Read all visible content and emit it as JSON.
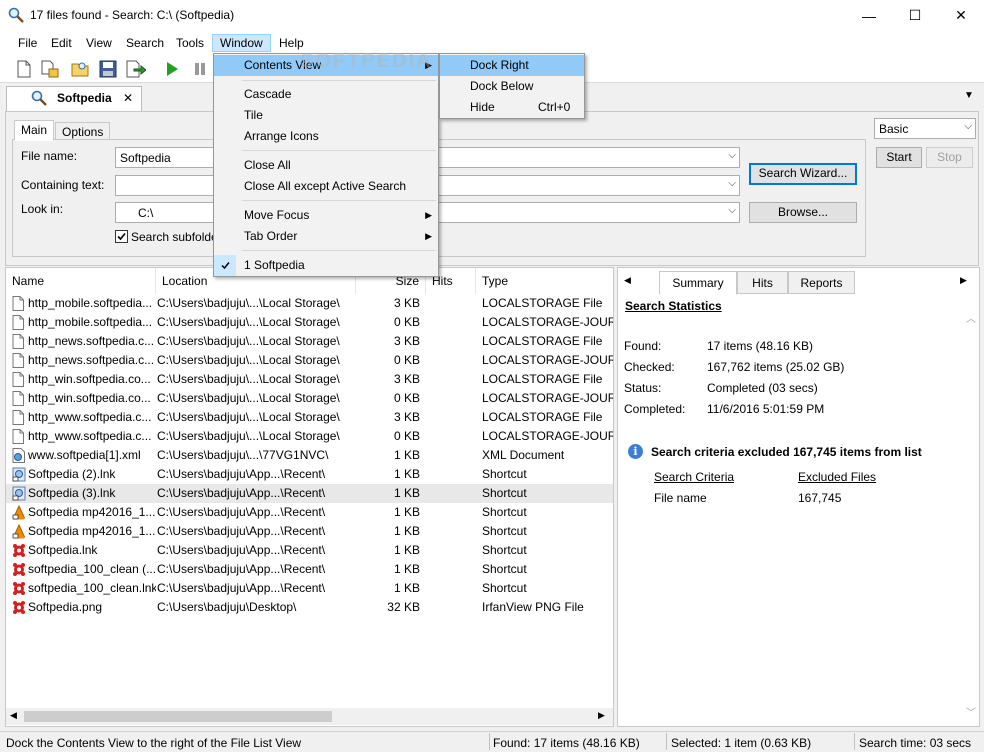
{
  "window": {
    "title": "17 files found - Search: C:\\ (Softpedia)",
    "minimize_glyph": "—",
    "maximize_glyph": "☐",
    "close_glyph": "✕"
  },
  "menubar": {
    "items": [
      "File",
      "Edit",
      "View",
      "Search",
      "Tools",
      "Window",
      "Help"
    ]
  },
  "doc_tab": {
    "label": "Softpedia",
    "close_glyph": "✕"
  },
  "search_panel": {
    "subtabs": [
      "Main",
      "Options"
    ],
    "file_name_label": "File name:",
    "file_name_value": "Softpedia",
    "containing_text_label": "Containing text:",
    "containing_text_value": "",
    "look_in_label": "Look in:",
    "look_in_value": "C:\\",
    "search_subfolders_label": "Search subfolders",
    "search_wizard_label": "Search Wizard...",
    "browse_label": "Browse...",
    "mode_value": "Basic",
    "start_label": "Start",
    "stop_label": "Stop"
  },
  "file_list": {
    "columns": [
      "Name",
      "Location",
      "Size",
      "Hits",
      "Type"
    ],
    "rows": [
      {
        "name": "http_mobile.softpedia...",
        "location": "C:\\Users\\badjuju\\...\\Local Storage\\",
        "size": "3 KB",
        "type": "LOCALSTORAGE File",
        "icon": "file-icon"
      },
      {
        "name": "http_mobile.softpedia...",
        "location": "C:\\Users\\badjuju\\...\\Local Storage\\",
        "size": "0 KB",
        "type": "LOCALSTORAGE-JOURN",
        "icon": "file-icon"
      },
      {
        "name": "http_news.softpedia.c...",
        "location": "C:\\Users\\badjuju\\...\\Local Storage\\",
        "size": "3 KB",
        "type": "LOCALSTORAGE File",
        "icon": "file-icon"
      },
      {
        "name": "http_news.softpedia.c...",
        "location": "C:\\Users\\badjuju\\...\\Local Storage\\",
        "size": "0 KB",
        "type": "LOCALSTORAGE-JOURN",
        "icon": "file-icon"
      },
      {
        "name": "http_win.softpedia.co...",
        "location": "C:\\Users\\badjuju\\...\\Local Storage\\",
        "size": "3 KB",
        "type": "LOCALSTORAGE File",
        "icon": "file-icon"
      },
      {
        "name": "http_win.softpedia.co...",
        "location": "C:\\Users\\badjuju\\...\\Local Storage\\",
        "size": "0 KB",
        "type": "LOCALSTORAGE-JOURN",
        "icon": "file-icon"
      },
      {
        "name": "http_www.softpedia.c...",
        "location": "C:\\Users\\badjuju\\...\\Local Storage\\",
        "size": "3 KB",
        "type": "LOCALSTORAGE File",
        "icon": "file-icon"
      },
      {
        "name": "http_www.softpedia.c...",
        "location": "C:\\Users\\badjuju\\...\\Local Storage\\",
        "size": "0 KB",
        "type": "LOCALSTORAGE-JOURN",
        "icon": "file-icon"
      },
      {
        "name": "www.softpedia[1].xml",
        "location": "C:\\Users\\badjuju\\...\\77VG1NVC\\",
        "size": "1 KB",
        "type": "XML Document",
        "icon": "xml-icon"
      },
      {
        "name": "Softpedia (2).lnk",
        "location": "C:\\Users\\badjuju\\App...\\Recent\\",
        "size": "1 KB",
        "type": "Shortcut",
        "icon": "shortcut-icon"
      },
      {
        "name": "Softpedia (3).lnk",
        "location": "C:\\Users\\badjuju\\App...\\Recent\\",
        "size": "1 KB",
        "type": "Shortcut",
        "icon": "shortcut-icon"
      },
      {
        "name": "Softpedia mp42016_1...",
        "location": "C:\\Users\\badjuju\\App...\\Recent\\",
        "size": "1 KB",
        "type": "Shortcut",
        "icon": "vlc-icon"
      },
      {
        "name": "Softpedia mp42016_1...",
        "location": "C:\\Users\\badjuju\\App...\\Recent\\",
        "size": "1 KB",
        "type": "Shortcut",
        "icon": "vlc-icon"
      },
      {
        "name": "Softpedia.lnk",
        "location": "C:\\Users\\badjuju\\App...\\Recent\\",
        "size": "1 KB",
        "type": "Shortcut",
        "icon": "irfan-icon"
      },
      {
        "name": "softpedia_100_clean (...",
        "location": "C:\\Users\\badjuju\\App...\\Recent\\",
        "size": "1 KB",
        "type": "Shortcut",
        "icon": "irfan-icon"
      },
      {
        "name": "softpedia_100_clean.lnk",
        "location": "C:\\Users\\badjuju\\App...\\Recent\\",
        "size": "1 KB",
        "type": "Shortcut",
        "icon": "irfan-icon"
      },
      {
        "name": "Softpedia.png",
        "location": "C:\\Users\\badjuju\\Desktop\\",
        "size": "32 KB",
        "type": "IrfanView PNG File",
        "icon": "irfan-icon"
      }
    ],
    "selected_index": 10
  },
  "summary": {
    "tabs": [
      "Summary",
      "Hits",
      "Reports"
    ],
    "heading": "Search Statistics",
    "stats": [
      {
        "label": "Found:",
        "value": "17 items (48.16 KB)"
      },
      {
        "label": "Checked:",
        "value": "167,762 items (25.02 GB)"
      },
      {
        "label": "Status:",
        "value": "Completed (03 secs)"
      },
      {
        "label": "Completed:",
        "value": "11/6/2016 5:01:59 PM"
      }
    ],
    "excluded_message": "Search criteria excluded 167,745 items from list",
    "criteria_header": "Search Criteria",
    "excluded_header": "Excluded Files",
    "criteria_name": "File name",
    "criteria_count": "167,745"
  },
  "window_menu": {
    "items": [
      {
        "label": "Contents View",
        "submenu": true,
        "highlight": true
      },
      {
        "label": "Cascade"
      },
      {
        "label": "Tile"
      },
      {
        "label": "Arrange Icons"
      },
      {
        "label": "Close All"
      },
      {
        "label": "Close All except Active Search"
      },
      {
        "label": "Move Focus",
        "submenu": true
      },
      {
        "label": "Tab Order",
        "submenu": true
      },
      {
        "label": "1 Softpedia",
        "checked": true
      }
    ]
  },
  "contents_submenu": {
    "items": [
      {
        "label": "Dock Right",
        "shortcut": "",
        "highlight": true
      },
      {
        "label": "Dock Below",
        "shortcut": ""
      },
      {
        "label": "Hide",
        "shortcut": "Ctrl+0"
      }
    ]
  },
  "watermark": "SOFTPEDIA",
  "statusbar": {
    "hint": "Dock the Contents View to the right of the File List View",
    "found": "Found: 17 items (48.16 KB)",
    "selected": "Selected: 1 item (0.63 KB)",
    "time": "Search time: 03 secs"
  }
}
